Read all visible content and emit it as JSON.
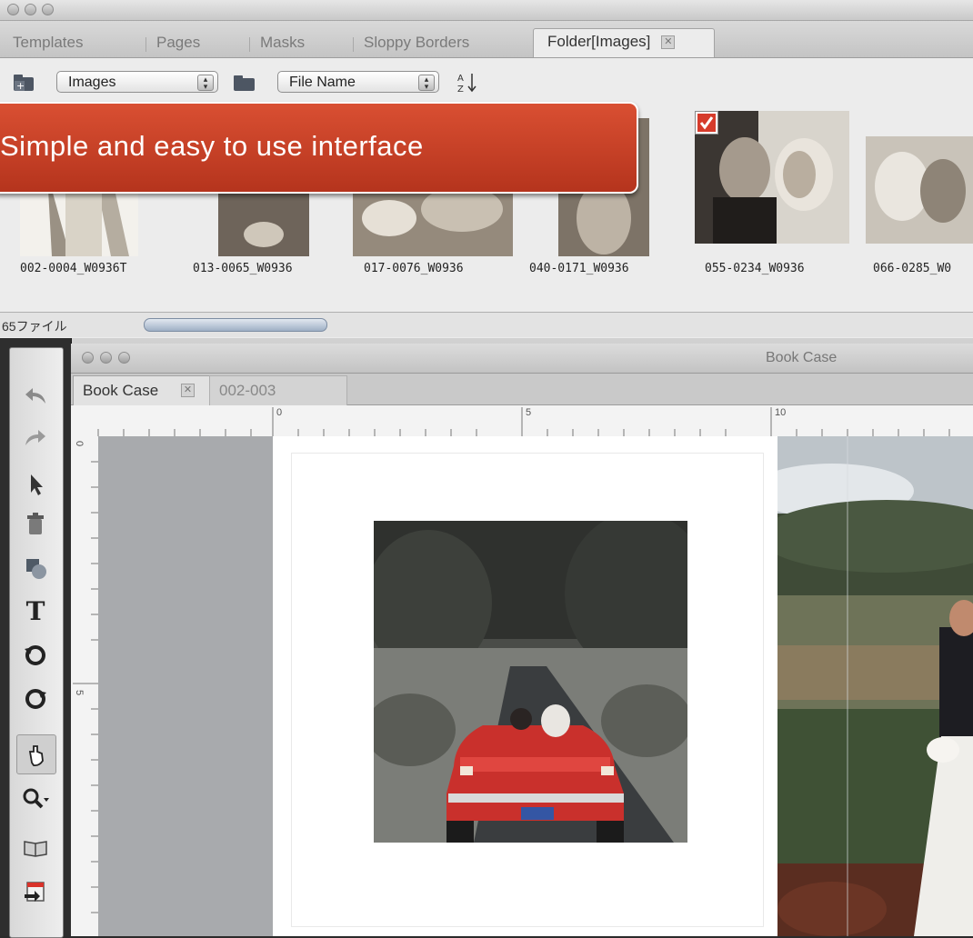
{
  "top_window": {
    "tabs": [
      {
        "label": "Templates"
      },
      {
        "label": "Pages"
      },
      {
        "label": "Masks"
      },
      {
        "label": "Sloppy Borders"
      },
      {
        "label": "Folder[Images]",
        "close_icon": "close-icon"
      }
    ],
    "toolbar": {
      "folder_select": "Images",
      "sort_select": "File Name",
      "sort_icon": "sort-az-icon",
      "add_icon": "add-folder-icon",
      "folder_icon": "folder-icon"
    },
    "thumbnails": [
      {
        "label": "002-0004_W0936T",
        "checked": false
      },
      {
        "label": "013-0065_W0936",
        "checked": false
      },
      {
        "label": "017-0076_W0936",
        "checked": false
      },
      {
        "label": "040-0171_W0936",
        "checked": false
      },
      {
        "label": "055-0234_W0936",
        "checked": true
      },
      {
        "label": "066-0285_W0"
      }
    ],
    "status": {
      "file_count": "65ファイル"
    }
  },
  "callout": {
    "text": "Simple and easy to use interface",
    "color": "#c8401f"
  },
  "book_window": {
    "title": "Book Case",
    "tabs": [
      {
        "label": "Book Case"
      },
      {
        "label": "002-003"
      }
    ],
    "ruler_h_labels": [
      "0",
      "5",
      "10"
    ],
    "ruler_v_labels": [
      "0",
      "5"
    ]
  },
  "tools": [
    "undo-icon",
    "redo-icon",
    "pointer-icon",
    "trash-icon",
    "shape-icon",
    "text-icon",
    "rotate-left-icon",
    "rotate-right-icon",
    "pan-icon",
    "zoom-icon",
    "book-icon",
    "export-icon"
  ]
}
